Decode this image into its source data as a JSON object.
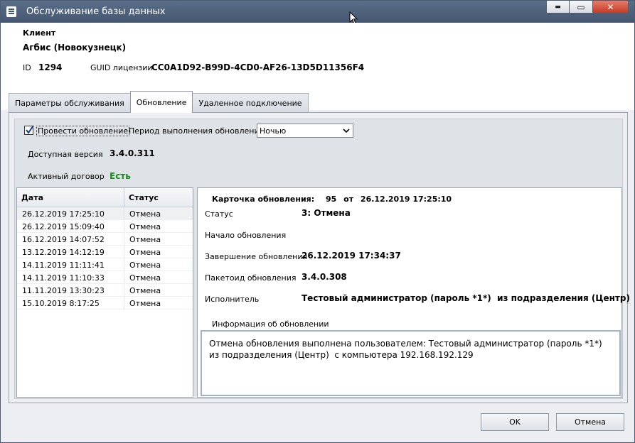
{
  "window": {
    "title": "Обслуживание базы данных",
    "app_icon": "database-app-icon",
    "controls": {
      "minimize": "▬",
      "maximize": "▭",
      "close": "✕"
    }
  },
  "client": {
    "label": "Клиент",
    "name": "Агбис (Новокузнецк)",
    "id_label": "ID",
    "id_value": "1294",
    "guid_label": "GUID лицензии",
    "guid_value": "CC0A1D92-B99D-4CD0-AF26-13D5D11356F4"
  },
  "tabs": [
    {
      "label": "Параметры обслуживания",
      "active": false
    },
    {
      "label": "Обновление",
      "active": true
    },
    {
      "label": "Удаленное подключение",
      "active": false
    }
  ],
  "update": {
    "perform_label": "Провести обновление",
    "perform_checked": true,
    "period_label": "Период выполнения обновления",
    "period_value": "Ночью",
    "version_label": "Доступная версия",
    "version_value": "3.4.0.311",
    "contract_label": "Активный договор",
    "contract_value": "Есть",
    "contract_color": "#1a8a1a"
  },
  "history": {
    "columns": {
      "date": "Дата",
      "status": "Статус"
    },
    "rows": [
      {
        "date": "26.12.2019 17:25:10",
        "status": "Отмена"
      },
      {
        "date": "26.12.2019 15:09:40",
        "status": "Отмена"
      },
      {
        "date": "16.12.2019 14:07:52",
        "status": "Отмена"
      },
      {
        "date": "13.12.2019 14:12:19",
        "status": "Отмена"
      },
      {
        "date": "14.11.2019 11:11:41",
        "status": "Отмена"
      },
      {
        "date": "14.11.2019 11:10:33",
        "status": "Отмена"
      },
      {
        "date": "11.11.2019 13:30:23",
        "status": "Отмена"
      },
      {
        "date": "15.10.2019 8:17:25",
        "status": "Отмена"
      }
    ]
  },
  "card": {
    "title_label": "Карточка обновления:",
    "number": "95",
    "from": "от",
    "datetime": "26.12.2019 17:25:10",
    "status_label": "Статус",
    "status_value": "3: Отмена",
    "start_label": "Начало обновления",
    "start_value": "",
    "end_label": "Завершение обновления",
    "end_value": "26.12.2019 17:34:37",
    "package_label": "Пакетоид обновления",
    "package_value": "3.4.0.308",
    "executor_label": "Исполнитель",
    "executor_value": "Тестовый администратор (пароль *1*)  из подразделения (Центр)",
    "info_label": "Информация об обновлении",
    "info_text": "Отмена обновления выполнена пользователем: Тестовый администратор (пароль *1*) из подразделения (Центр)  с компьютера 192.168.192.129"
  },
  "buttons": {
    "ok": "OK",
    "cancel": "Отмена"
  }
}
